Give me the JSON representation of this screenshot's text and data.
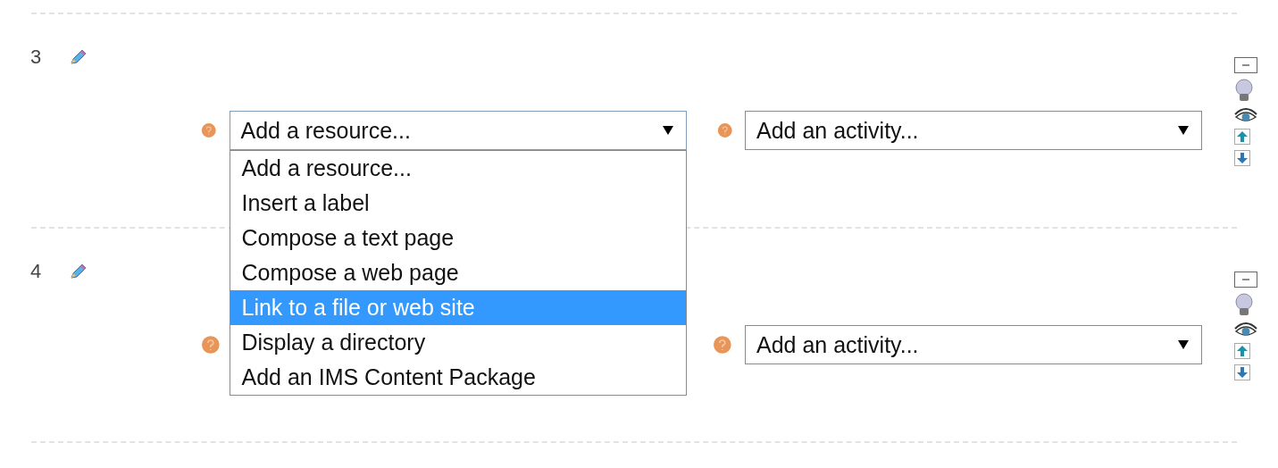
{
  "sections": [
    {
      "number": "3",
      "resource_select": {
        "value": "Add a resource...",
        "expanded": true,
        "options": [
          {
            "label": "Add a resource...",
            "highlighted": false
          },
          {
            "label": "Insert a label",
            "highlighted": false
          },
          {
            "label": "Compose a text page",
            "highlighted": false
          },
          {
            "label": "Compose a web page",
            "highlighted": false
          },
          {
            "label": "Link to a file or web site",
            "highlighted": true
          },
          {
            "label": "Display a directory",
            "highlighted": false
          },
          {
            "label": "Add an IMS Content Package",
            "highlighted": false
          }
        ]
      },
      "activity_select": {
        "value": "Add an activity..."
      }
    },
    {
      "number": "4",
      "activity_select": {
        "value": "Add an activity..."
      }
    }
  ]
}
